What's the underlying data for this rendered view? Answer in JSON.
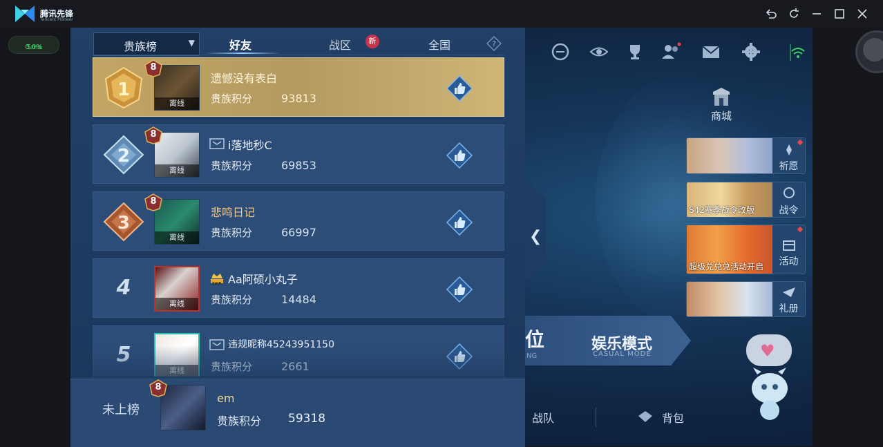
{
  "titlebar": {
    "app_name": "腾讯先锋",
    "app_sub": "Tencent Pioneer",
    "latency": "5ms",
    "loss": "0.0%",
    "icons": [
      "undo-icon",
      "refresh-icon",
      "minimize-icon",
      "maximize-icon",
      "close-icon"
    ]
  },
  "panel": {
    "filter_label": "贵族榜",
    "tabs": [
      {
        "label": "好友",
        "active": true
      },
      {
        "label": "战区",
        "badge": "新"
      },
      {
        "label": "全国"
      }
    ],
    "help_glyph": "?",
    "offline_label": "离线",
    "score_label": "贵族积分",
    "rows": [
      {
        "rank": "1",
        "level": "8",
        "name": "遗憾没有表白",
        "score": "93813"
      },
      {
        "rank": "2",
        "level": "8",
        "name": "i落地秒C",
        "score": "69853"
      },
      {
        "rank": "3",
        "level": "8",
        "name": "悲鸣日记",
        "score": "66997"
      },
      {
        "rank": "4",
        "name": "Aa阿硕小丸子",
        "score": "14484",
        "svip": "SVIP"
      },
      {
        "rank": "5",
        "name": "违规昵称45243951150",
        "score": "2661"
      }
    ],
    "mine": {
      "rank_label": "未上榜",
      "level": "8",
      "name": "em",
      "score": "59318"
    }
  },
  "game": {
    "shop_label": "商城",
    "banners": [
      {
        "side_label": "祈愿",
        "promo": ""
      },
      {
        "side_label": "战令",
        "promo": "S42赛季战令改版"
      },
      {
        "side_label": "活动",
        "promo": "超级兑兑兑活动开启"
      },
      {
        "side_label": "礼册",
        "promo": ""
      }
    ],
    "mode_left": "位",
    "mode_left_sub": "NG",
    "mode_title": "娱乐模式",
    "mode_sub": "CASUAL MODE",
    "nav_team": "战队",
    "nav_bag": "背包"
  }
}
